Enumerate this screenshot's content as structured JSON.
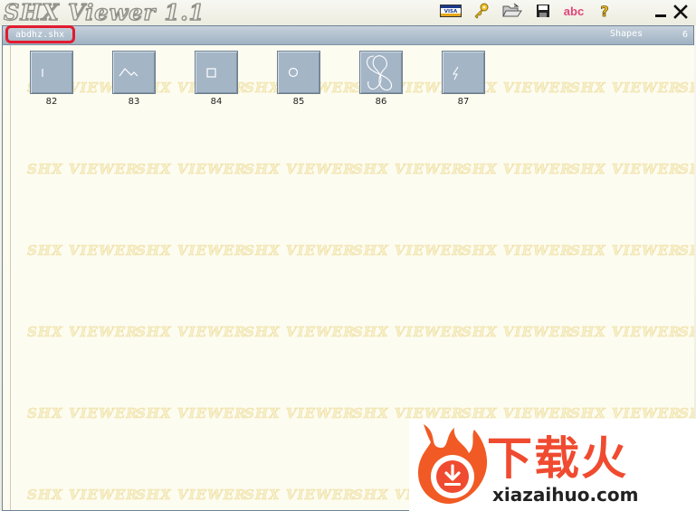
{
  "window": {
    "title": "SHX Viewer 1.1"
  },
  "toolbar": {
    "buttons": [
      {
        "name": "visa-icon",
        "label": "VISA"
      },
      {
        "name": "key-icon"
      },
      {
        "name": "folder-open-icon"
      },
      {
        "name": "save-icon"
      },
      {
        "name": "font-abc-icon",
        "label": "abc"
      },
      {
        "name": "help-icon",
        "label": "?"
      }
    ]
  },
  "file_bar": {
    "file_name": "abdhz.shx",
    "shapes_label": "Shapes",
    "shapes_count": "6"
  },
  "shapes": [
    {
      "id": "82",
      "glyph": "vertical-line"
    },
    {
      "id": "83",
      "glyph": "wave"
    },
    {
      "id": "84",
      "glyph": "square"
    },
    {
      "id": "85",
      "glyph": "circle"
    },
    {
      "id": "86",
      "glyph": "figure-eight"
    },
    {
      "id": "87",
      "glyph": "lightning"
    }
  ],
  "watermark": "SHX VIEWER",
  "logo": {
    "cn_text": "下载火",
    "en_text": "xiazaihuo.com"
  },
  "colors": {
    "header_blue": "#a9bccc",
    "thumb_bg": "#a4b5c6",
    "highlight_red": "#e31b2f",
    "logo_orange": "#f04b30"
  }
}
